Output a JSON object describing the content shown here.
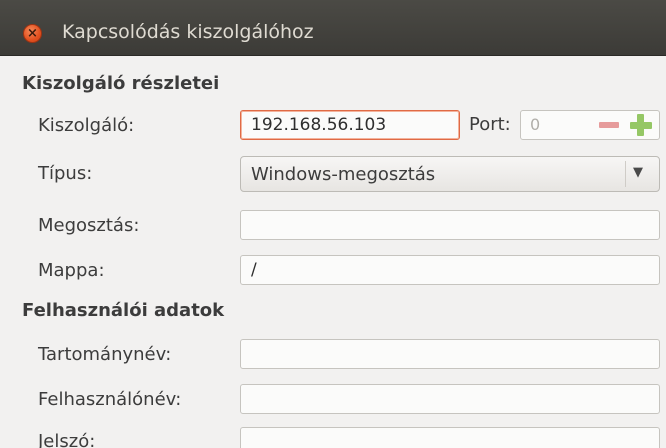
{
  "window": {
    "title": "Kapcsolódás kiszolgálóhoz",
    "close_glyph": "×"
  },
  "server_section": {
    "heading": "Kiszolgáló részletei",
    "server_label": "Kiszolgáló:",
    "server_value": "192.168.56.103",
    "port_label": "Port:",
    "port_value": "0",
    "type_label": "Típus:",
    "type_value": "Windows-megosztás",
    "share_label": "Megosztás:",
    "share_value": "",
    "folder_label": "Mappa:",
    "folder_value": "/"
  },
  "user_section": {
    "heading": "Felhasználói adatok",
    "domain_label": "Tartománynév:",
    "domain_value": "",
    "username_label": "Felhasználónév:",
    "username_value": "",
    "password_label": "Jelszó:",
    "password_value": ""
  },
  "icons": {
    "close": "close-icon",
    "decrement": "minus-icon",
    "increment": "plus-icon",
    "dropdown": "chevron-down-icon"
  },
  "colors": {
    "titlebar": "#3c3b37",
    "close_button": "#e2501f",
    "focus_border": "#e06a45",
    "window_bg": "#f2f1f0"
  }
}
